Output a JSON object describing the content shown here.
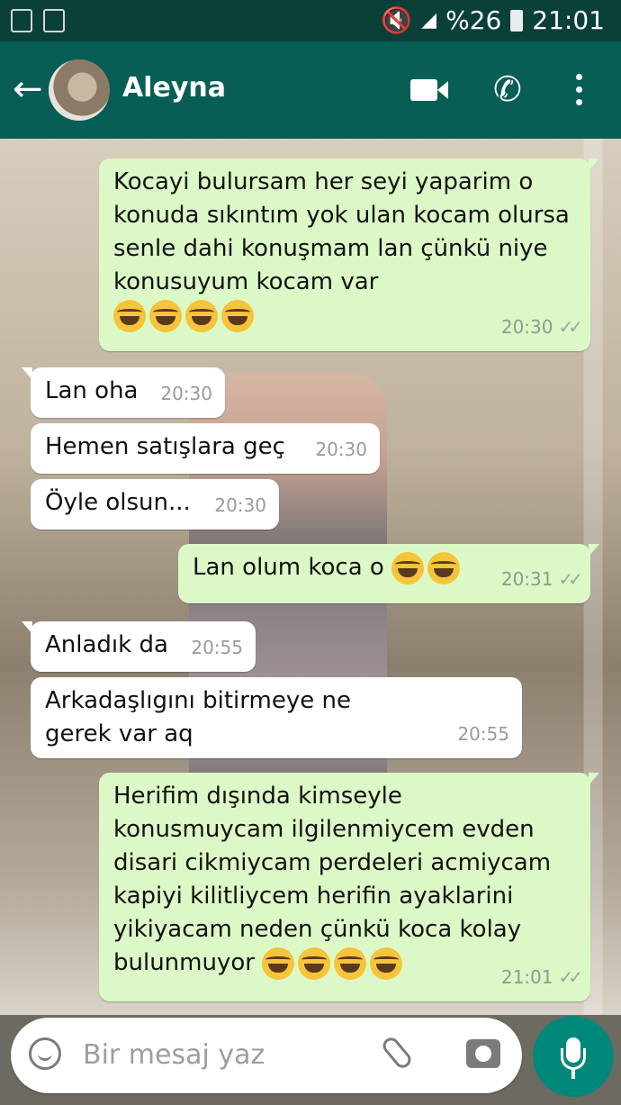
{
  "status_bar": {
    "battery_percent": "%26",
    "time": "21:01"
  },
  "header": {
    "contact_name": "Aleyna"
  },
  "messages": [
    {
      "id": "m1",
      "dir": "out",
      "text": "Kocayi bulursam her seyi yaparim o konuda sıkıntım yok ulan kocam olursa senle dahi konuşmam lan çünkü niye konusuyum kocam var",
      "emoji_count": 4,
      "time": "20:30"
    },
    {
      "id": "m2",
      "dir": "in",
      "text": "Lan oha",
      "time": "20:30"
    },
    {
      "id": "m3",
      "dir": "in",
      "text": "Hemen satışlara geç",
      "time": "20:30"
    },
    {
      "id": "m4",
      "dir": "in",
      "text": "Öyle olsun...",
      "time": "20:30"
    },
    {
      "id": "m5",
      "dir": "out",
      "text": "Lan olum koca o",
      "emoji_count": 2,
      "time": "20:31"
    },
    {
      "id": "m6",
      "dir": "in",
      "text": "Anladık da",
      "time": "20:55"
    },
    {
      "id": "m7",
      "dir": "in",
      "text": "Arkadaşlıgını bitirmeye ne gerek var aq",
      "time": "20:55"
    },
    {
      "id": "m8",
      "dir": "out",
      "text": "Herifim dışında kimseyle konusmuycam ilgilenmiycem evden disari cikmiycam perdeleri acmiycam kapiyi kilitliycem herifin ayaklarini yikiyacam neden çünkü koca kolay bulunmuyor",
      "emoji_count": 4,
      "time": "21:01"
    }
  ],
  "input": {
    "placeholder": "Bir mesaj yaz"
  },
  "colors": {
    "header": "#075e54",
    "status": "#0b4038",
    "outgoing": "#dcf8c6",
    "incoming": "#ffffff",
    "fab": "#00897b"
  },
  "icons": [
    "back-arrow-icon",
    "video-call-icon",
    "phone-icon",
    "more-icon",
    "emoji-icon",
    "attach-icon",
    "camera-icon",
    "mic-icon",
    "read-ticks-icon"
  ]
}
